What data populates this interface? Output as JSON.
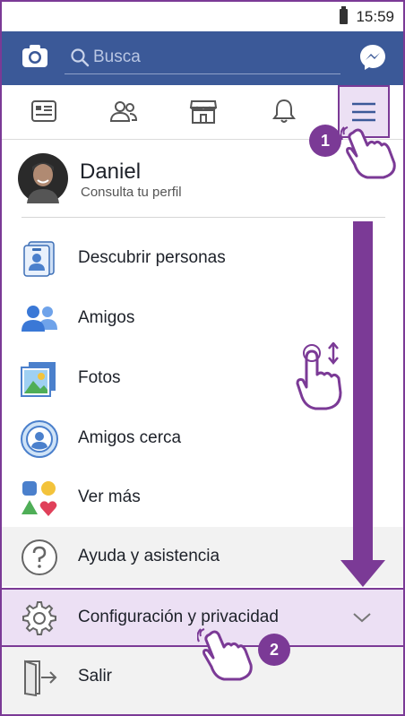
{
  "status_bar": {
    "time": "15:59"
  },
  "header": {
    "search_placeholder": "Busca"
  },
  "profile": {
    "name": "Daniel",
    "subtitle": "Consulta tu perfil"
  },
  "menu": [
    {
      "label": "Descubrir personas",
      "icon": "discover-people-icon"
    },
    {
      "label": "Amigos",
      "icon": "friends-icon"
    },
    {
      "label": "Fotos",
      "icon": "photos-icon"
    },
    {
      "label": "Amigos cerca",
      "icon": "nearby-friends-icon"
    },
    {
      "label": "Ver más",
      "icon": "see-more-icon"
    },
    {
      "label": "Ayuda y asistencia",
      "icon": "help-icon"
    },
    {
      "label": "Configuración y privacidad",
      "icon": "gear-icon"
    },
    {
      "label": "Salir",
      "icon": "logout-icon"
    }
  ],
  "annotations": {
    "step1": "1",
    "step2": "2"
  },
  "colors": {
    "brand": "#3b5998",
    "accent": "#7b3a96"
  }
}
